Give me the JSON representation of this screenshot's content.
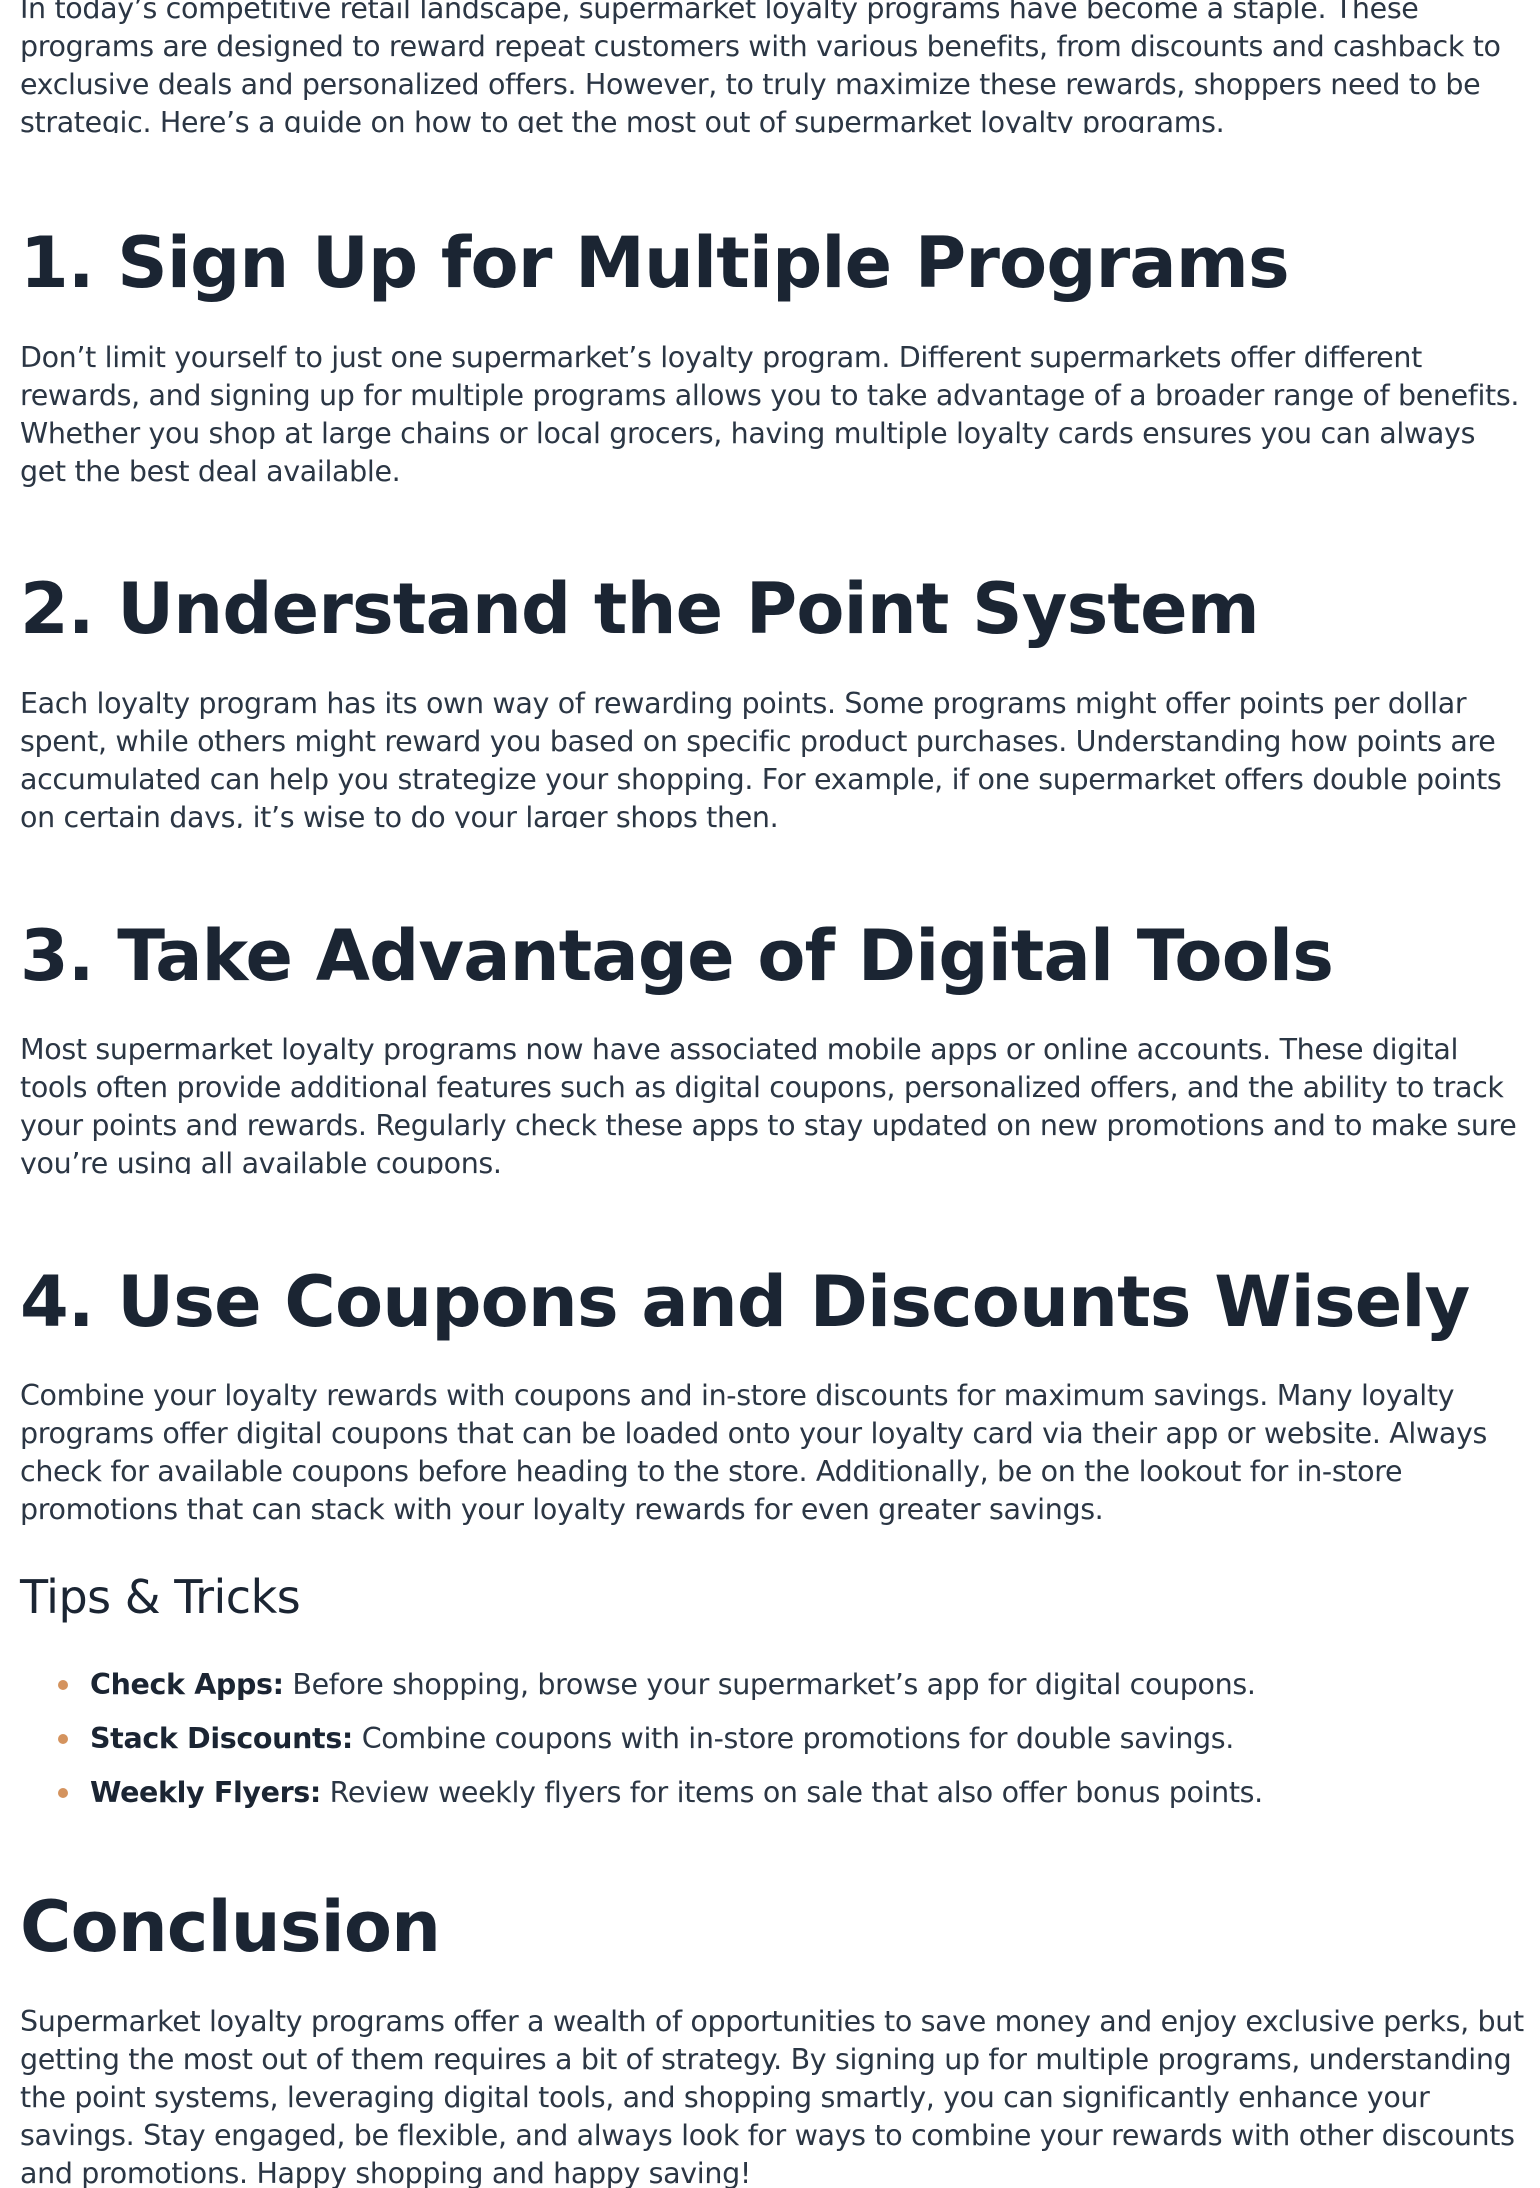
{
  "intro": "In today’s competitive retail landscape, supermarket loyalty programs have become a staple. These programs are designed to reward repeat customers with various benefits, from discounts and cashback to exclusive deals and personalized offers. However, to truly maximize these rewards, shoppers need to be strategic. Here’s a guide on how to get the most out of supermarket loyalty programs.",
  "sections": [
    {
      "heading": "1. Sign Up for Multiple Programs",
      "body": "Don’t limit yourself to just one supermarket’s loyalty program. Different supermarkets offer different rewards, and signing up for multiple programs allows you to take advantage of a broader range of benefits. Whether you shop at large chains or local grocers, having multiple loyalty cards ensures you can always get the best deal available."
    },
    {
      "heading": "2. Understand the Point System",
      "body": "Each loyalty program has its own way of rewarding points. Some programs might offer points per dollar spent, while others might reward you based on specific product purchases. Understanding how points are accumulated can help you strategize your shopping. For example, if one supermarket offers double points on certain days, it’s wise to do your larger shops then."
    },
    {
      "heading": "3. Take Advantage of Digital Tools",
      "body": "Most supermarket loyalty programs now have associated mobile apps or online accounts. These digital tools often provide additional features such as digital coupons, personalized offers, and the ability to track your points and rewards. Regularly check these apps to stay updated on new promotions and to make sure you’re using all available coupons."
    },
    {
      "heading": "4. Use Coupons and Discounts Wisely",
      "body": "Combine your loyalty rewards with coupons and in-store discounts for maximum savings. Many loyalty programs offer digital coupons that can be loaded onto your loyalty card via their app or website. Always check for available coupons before heading to the store. Additionally, be on the lookout for in-store promotions that can stack with your loyalty rewards for even greater savings."
    }
  ],
  "tips": {
    "heading": "Tips & Tricks",
    "items": [
      {
        "label": "Check Apps:",
        "text": " Before shopping, browse your supermarket’s app for digital coupons."
      },
      {
        "label": "Stack Discounts:",
        "text": " Combine coupons with in-store promotions for double savings."
      },
      {
        "label": "Weekly Flyers:",
        "text": " Review weekly flyers for items on sale that also offer bonus points."
      }
    ]
  },
  "conclusion": {
    "heading": "Conclusion",
    "body": "Supermarket loyalty programs offer a wealth of opportunities to save money and enjoy exclusive perks, but getting the most out of them requires a bit of strategy. By signing up for multiple programs, understanding the point systems, leveraging digital tools, and shopping smartly, you can significantly enhance your savings. Stay engaged, be flexible, and always look for ways to combine your rewards with other discounts and promotions. Happy shopping and happy saving!"
  },
  "colors": {
    "text": "#2b3644",
    "heading": "#1b2533",
    "bullet": "#d4935e",
    "background": "#ffffff"
  }
}
